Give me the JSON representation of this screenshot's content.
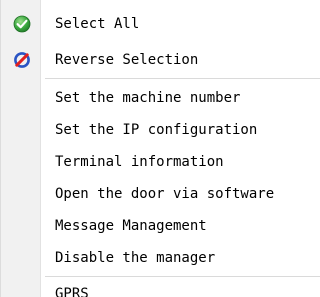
{
  "menu": {
    "items": [
      {
        "label": "Select All",
        "icon": "check-circle-icon"
      },
      {
        "label": "Reverse Selection",
        "icon": "no-entry-icon"
      },
      {
        "label": "Set the machine number"
      },
      {
        "label": "Set the IP configuration"
      },
      {
        "label": "Terminal information"
      },
      {
        "label": "Open the door via software"
      },
      {
        "label": "Message Management"
      },
      {
        "label": "Disable the manager"
      },
      {
        "label": "GPRS"
      }
    ]
  },
  "colors": {
    "check_icon": "#35a84a",
    "no_entry_outer": "#2a54c4",
    "no_entry_slash": "#e02020",
    "gutter": "#f1f1f1",
    "separator": "#dadada"
  }
}
